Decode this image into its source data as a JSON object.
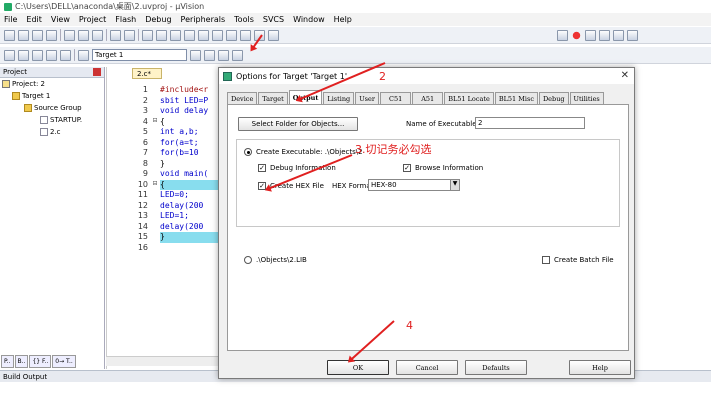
{
  "window": {
    "title": "C:\\Users\\DELL\\anaconda\\桌面\\2.uvproj - µVision"
  },
  "menu": [
    "File",
    "Edit",
    "View",
    "Project",
    "Flash",
    "Debug",
    "Peripherals",
    "Tools",
    "SVCS",
    "Window",
    "Help"
  ],
  "toolbar2": {
    "target": "Target 1"
  },
  "project_panel": {
    "title": "Project",
    "tree": [
      "Project: 2",
      "Target 1",
      "Source Group",
      "STARTUP.",
      "2.c"
    ]
  },
  "editor": {
    "tab": "2.c*",
    "line_numbers": [
      "1",
      "2",
      "3",
      "4",
      "5",
      "6",
      "7",
      "8",
      "9",
      "10",
      "11",
      "12",
      "13",
      "14",
      "15",
      "16"
    ],
    "lines": [
      "#include<r",
      "sbit LED=P",
      "void delay",
      "{",
      "  int a,b;",
      "  for(a=t;",
      "  for(b=10",
      "}",
      "void main(",
      "{",
      "  LED=0;",
      "  delay(200",
      "  LED=1;",
      "  delay(200",
      "}",
      ""
    ]
  },
  "bottom_tabs": [
    "P..",
    "B..",
    "{} F..",
    "0→ T.."
  ],
  "status": "Build Output",
  "dialog": {
    "title": "Options for Target 'Target 1'",
    "tabs": [
      "Device",
      "Target",
      "Output",
      "Listing",
      "User",
      "C51",
      "A51",
      "BL51 Locate",
      "BL51 Misc",
      "Debug",
      "Utilities"
    ],
    "active_tab": "Output",
    "select_folder": "Select Folder for Objects...",
    "name_label": "Name of Executable:",
    "name_value": "2",
    "create_exec": "Create Executable:  .\\Objects\\2",
    "debug_info": "Debug Information",
    "browse_info": "Browse Information",
    "create_hex": "Create HEX File",
    "hex_format_label": "HEX Format:",
    "hex_format_value": "HEX-80",
    "lib_option": ".\\Objects\\2.LIB",
    "batch_file": "Create Batch File",
    "buttons": {
      "ok": "OK",
      "cancel": "Cancel",
      "defaults": "Defaults",
      "help": "Help"
    }
  },
  "annotations": {
    "a2": "2",
    "a3": "3.切记务必勾选",
    "a4": "4"
  },
  "colors": {
    "annotation": "#e02020",
    "keyword": "#0000cc"
  }
}
